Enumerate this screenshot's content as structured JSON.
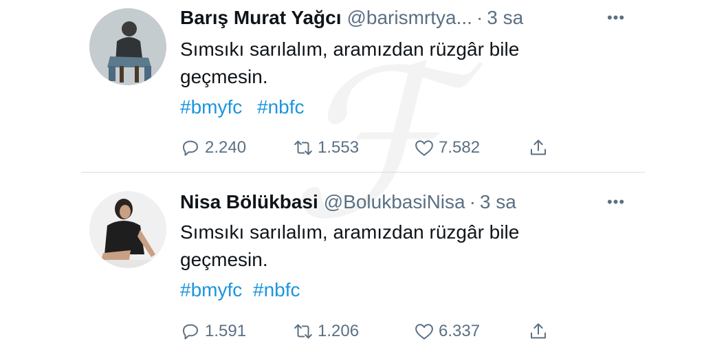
{
  "tweets": [
    {
      "author": "Barış Murat Yağcı",
      "handle": "@barismrtya...",
      "separator": "·",
      "time": "3 sa",
      "text": "Sımsıkı sarılalım, aramızdan rüzgâr bile geçmesin.",
      "hashtags": [
        "#bmyfc",
        "#nbfc"
      ],
      "replies": "2.240",
      "retweets": "1.553",
      "likes": "7.582"
    },
    {
      "author": "Nisa Bölükbasi",
      "handle": "@BolukbasiNisa",
      "separator": "·",
      "time": "3 sa",
      "text": "Sımsıkı sarılalım, aramızdan rüzgâr bile geçmesin.",
      "hashtags": [
        "#bmyfc",
        "#nbfc"
      ],
      "replies": "1.591",
      "retweets": "1.206",
      "likes": "6.337"
    }
  ],
  "icons": {
    "more": "more-icon",
    "reply": "reply-icon",
    "retweet": "retweet-icon",
    "like": "heart-icon",
    "share": "share-icon"
  },
  "colors": {
    "text": "#0f1419",
    "muted": "#5b7083",
    "link": "#1b95e0",
    "divider": "#d9dde1"
  }
}
